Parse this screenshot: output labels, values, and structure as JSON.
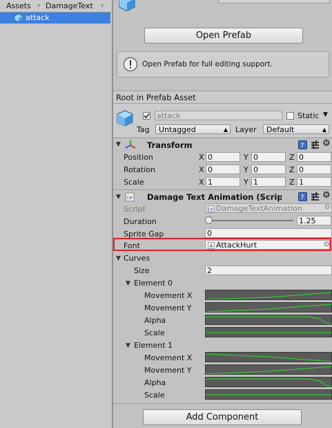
{
  "project": {
    "breadcrumb": [
      "Assets",
      "DamageText"
    ],
    "selected_item": "attack"
  },
  "inspector": {
    "open_prefab_button": "Open Prefab",
    "help_text": "Open Prefab for full editing support.",
    "root_header": "Root in Prefab Asset",
    "object": {
      "name": "attack",
      "static_label": "Static",
      "tag_label": "Tag",
      "tag_value": "Untagged",
      "layer_label": "Layer",
      "layer_value": "Default"
    },
    "transform": {
      "title": "Transform",
      "rows": [
        {
          "label": "Position",
          "x": "0",
          "y": "0",
          "z": "0"
        },
        {
          "label": "Rotation",
          "x": "0",
          "y": "0",
          "z": "0"
        },
        {
          "label": "Scale",
          "x": "1",
          "y": "1",
          "z": "1"
        }
      ],
      "axis": [
        "X",
        "Y",
        "Z"
      ]
    },
    "damage_text": {
      "title": "Damage Text Animation (Scrip",
      "script_label": "Script",
      "script_value": "DamageTextAnimation",
      "duration_label": "Duration",
      "duration_value": "1.25",
      "duration_fraction": 0.0,
      "sprite_gap_label": "Sprite Gap",
      "sprite_gap_value": "0",
      "font_label": "Font",
      "font_value": "AttackHurt"
    },
    "curves": {
      "label": "Curves",
      "size_label": "Size",
      "size_value": "2",
      "elements": [
        {
          "label": "Element 0",
          "fields": [
            "Movement X",
            "Movement Y",
            "Alpha",
            "Scale"
          ]
        },
        {
          "label": "Element 1",
          "fields": [
            "Movement X",
            "Movement Y",
            "Alpha",
            "Scale"
          ]
        }
      ]
    },
    "add_component_button": "Add Component"
  },
  "colors": {
    "selection": "#3d80df",
    "highlight_border": "#e0202a",
    "curve_line": "#29e029",
    "curve_bg": "#5a5a5a"
  }
}
